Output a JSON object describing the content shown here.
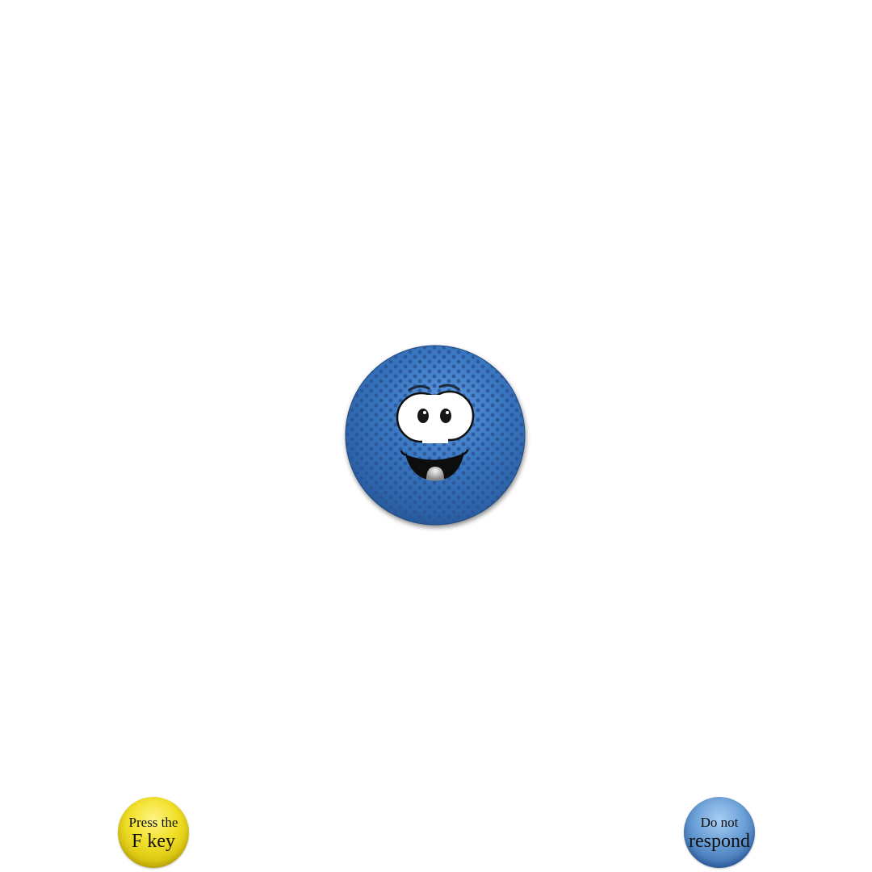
{
  "stimulus": {
    "icon": "smiling-blue-ball-icon",
    "ball_color": "#3a78c2",
    "dot_color": "#2a5596"
  },
  "cues": {
    "go": {
      "line1": "Press the",
      "line2": "F key",
      "color": "#f2e12a"
    },
    "nogo": {
      "line1": "Do not",
      "line2": "respond",
      "color": "#4a80c2"
    }
  }
}
